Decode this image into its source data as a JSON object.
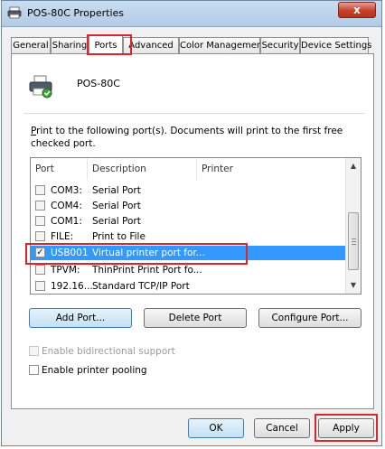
{
  "window": {
    "title": "POS-80C Properties",
    "close_label": "x"
  },
  "tabs": [
    {
      "label": "General",
      "active": false
    },
    {
      "label": "Sharing",
      "active": false
    },
    {
      "label": "Ports",
      "active": true
    },
    {
      "label": "Advanced",
      "active": false
    },
    {
      "label": "Color Management",
      "active": false
    },
    {
      "label": "Security",
      "active": false
    },
    {
      "label": "Device Settings",
      "active": false
    }
  ],
  "printer": {
    "name": "POS-80C",
    "icon": "printer-icon"
  },
  "description_lead": "P",
  "description_rest": "rint to the following port(s). Documents will print to the first free checked port.",
  "ports_list": {
    "headers": [
      "Port",
      "Description",
      "Printer"
    ],
    "rows": [
      {
        "port": "COM3:",
        "description": "Serial Port",
        "printer": "",
        "checked": false,
        "selected": false
      },
      {
        "port": "COM4:",
        "description": "Serial Port",
        "printer": "",
        "checked": false,
        "selected": false
      },
      {
        "port": "COM1:",
        "description": "Serial Port",
        "printer": "",
        "checked": false,
        "selected": false
      },
      {
        "port": "FILE:",
        "description": "Print to File",
        "printer": "",
        "checked": false,
        "selected": false
      },
      {
        "port": "USB001",
        "description": "Virtual printer port for...",
        "printer": "",
        "checked": true,
        "selected": true
      },
      {
        "port": "TPVM:",
        "description": "ThinPrint Print Port fo...",
        "printer": "",
        "checked": false,
        "selected": false
      },
      {
        "port": "192.16...",
        "description": "Standard TCP/IP Port",
        "printer": "",
        "checked": false,
        "selected": false
      }
    ]
  },
  "buttons": {
    "add_port": "Add Port...",
    "delete_port": "Delete Port",
    "configure_port": "Configure Port...",
    "ok": "OK",
    "cancel": "Cancel",
    "apply": "Apply"
  },
  "options": {
    "bidirectional": {
      "label": "Enable bidirectional support",
      "checked": false,
      "enabled": false
    },
    "pooling": {
      "label": "Enable printer pooling",
      "checked": false,
      "enabled": true
    }
  },
  "colors": {
    "highlight_box": "#d9252c",
    "selection": "#3399ff",
    "title_close": "#c7402a"
  }
}
